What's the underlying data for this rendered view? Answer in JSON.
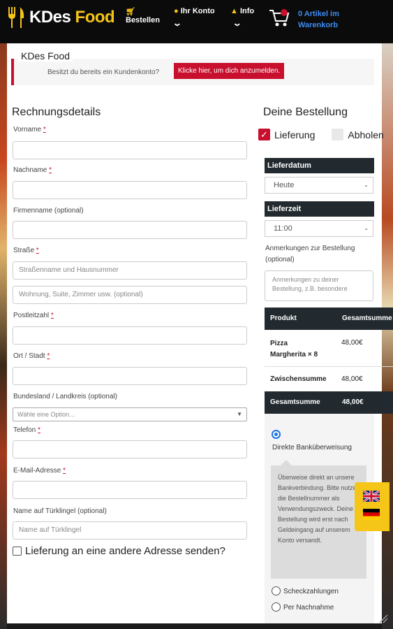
{
  "header": {
    "logo_main": "KDes",
    "logo_accent": "Food",
    "nav": [
      {
        "label": "Bestellen",
        "icon": "cart-icon"
      },
      {
        "label": "Ihr Konto",
        "icon": "user-icon"
      },
      {
        "label": "Info",
        "icon": "shield-icon"
      }
    ],
    "cart_line1": "0 Artikel im",
    "cart_line2": "Warenkorb",
    "colors": {
      "bar": "#0b0b0b",
      "accent": "#f5c518",
      "link": "#3d8bf0"
    }
  },
  "notice": {
    "title": "KDes Food",
    "text": "Besitzt du bereits ein Kundenkonto?",
    "button": "Klicke hier, um dich anzumelden."
  },
  "billing": {
    "heading": "Rechnungsdetails",
    "fields": {
      "firstname": {
        "label": "Vorname",
        "required": "*"
      },
      "lastname": {
        "label": "Nachname",
        "required": "*"
      },
      "company": {
        "label": "Firmenname (optional)"
      },
      "street": {
        "label": "Straße",
        "required": "*",
        "placeholder1": "Straßenname und Hausnummer",
        "placeholder2": "Wohnung, Suite, Zimmer usw. (optional)"
      },
      "zip": {
        "label": "Postleitzahl",
        "required": "*"
      },
      "city": {
        "label": "Ort / Stadt",
        "required": "*"
      },
      "state": {
        "label": "Bundesland / Landkreis (optional)",
        "placeholder": "Wähle eine Option…"
      },
      "phone": {
        "label": "Telefon",
        "required": "*"
      },
      "email": {
        "label": "E-Mail-Adresse",
        "required": "*"
      },
      "doorbell": {
        "label": "Name auf Türklingel (optional)",
        "placeholder": "Name auf Türklingel"
      }
    },
    "ship_different": "Lieferung an eine andere Adresse senden?"
  },
  "order": {
    "heading": "Deine Bestellung",
    "delivery_label": "Lieferung",
    "pickup_label": "Abholen",
    "date_label": "Lieferdatum",
    "date_value": "Heute",
    "time_label": "Lieferzeit",
    "time_value": "11:00",
    "notes_label": "Anmerkungen zur Bestellung (optional)",
    "notes_placeholder": "Anmerkungen zu deiner Bestellung, z.B. besondere",
    "table": {
      "col_product": "Produkt",
      "col_total": "Gesamtsumme",
      "item_name": "Pizza Margherita",
      "item_qty": "× 8",
      "item_price": "48,00€",
      "subtotal_label": "Zwischensumme",
      "subtotal_value": "48,00€",
      "total_label": "Gesamtsumme",
      "total_value": "48,00€"
    },
    "payment": {
      "bank": "Direkte Banküberweisung",
      "bank_desc": "Überweise direkt an unsere Bankverbindung. Bitte nutze die Bestellnummer als Verwendungszweck. Deine Bestellung wird erst nach Geldeingang auf unserem Konto versandt.",
      "cheque": "Scheckzahlungen",
      "cod": "Per Nachnahme"
    }
  }
}
